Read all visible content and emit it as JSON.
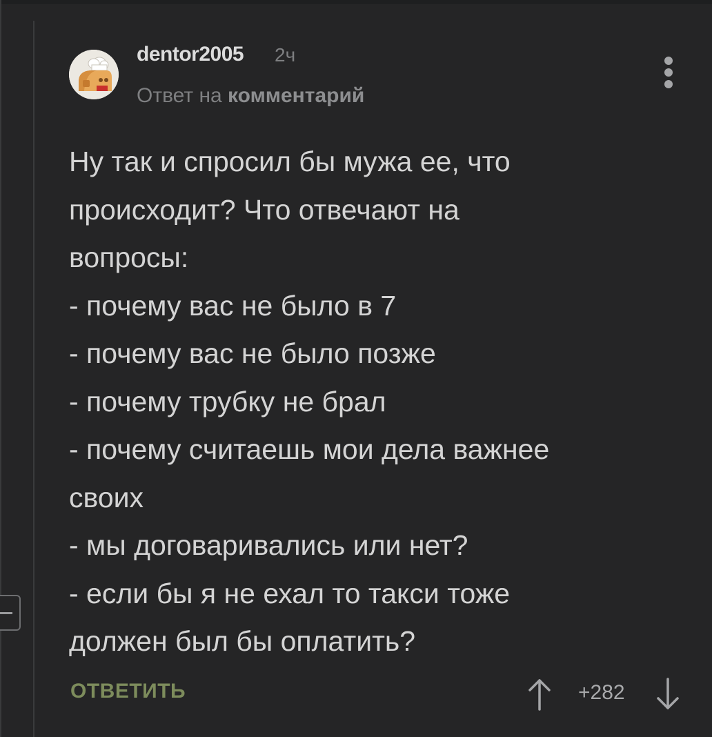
{
  "comment": {
    "author": "dentor2005",
    "time": "2ч",
    "reply_prefix": "Ответ на",
    "reply_link": "комментарий",
    "body_lines": [
      "Ну так и спросил бы мужа ее, что",
      "происходит? Что отвечают на",
      "вопросы:",
      "- почему вас не было в 7",
      "- почему вас не было позже",
      "- почему трубку не брал",
      "- почему считаешь мои дела важнее",
      "своих",
      "- мы договаривались или нет?",
      "- если бы я не ехал то такси тоже",
      "должен был бы оплатить?"
    ],
    "reply_label": "ОТВЕТИТЬ",
    "rating": "+282"
  },
  "icons": {
    "menu": "more-vertical-icon",
    "upvote": "arrow-up-icon",
    "downvote": "arrow-down-icon",
    "collapse": "minus-icon"
  },
  "colors": {
    "background": "#252526",
    "reply_accent": "#7d8c5c",
    "muted_text": "#7e7f81"
  }
}
